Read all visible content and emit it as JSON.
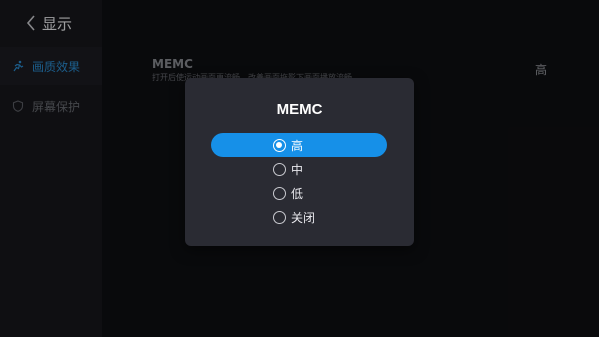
{
  "header": {
    "title": "显示",
    "back_icon": "chevron-left-icon"
  },
  "sidebar": {
    "items": [
      {
        "label": "画质效果",
        "icon": "run-icon",
        "active": true
      },
      {
        "label": "屏幕保护",
        "icon": "shield-icon",
        "active": false
      }
    ]
  },
  "setting": {
    "title": "MEMC",
    "description": "打开后使运动画面更流畅，改善画面拖影下画面播放流畅",
    "value": "高"
  },
  "dialog": {
    "title": "MEMC",
    "options": [
      {
        "label": "高",
        "selected": true
      },
      {
        "label": "中",
        "selected": false
      },
      {
        "label": "低",
        "selected": false
      },
      {
        "label": "关闭",
        "selected": false
      }
    ]
  },
  "colors": {
    "accent": "#1690e8",
    "dialog_bg": "#2a2b33",
    "page_bg": "#111216"
  }
}
